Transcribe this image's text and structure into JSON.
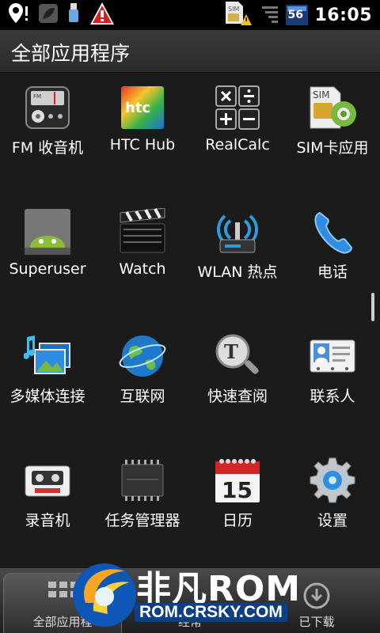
{
  "status_bar": {
    "time": "16:05",
    "network": "56",
    "sim_label": "SIM"
  },
  "header": {
    "title": "全部应用程序"
  },
  "apps": [
    {
      "label": "FM 收音机",
      "icon": "radio-icon"
    },
    {
      "label": "HTC Hub",
      "icon": "htc-hub-icon",
      "icon_text": "htc"
    },
    {
      "label": "RealCalc",
      "icon": "calculator-icon"
    },
    {
      "label": "SIM卡应用",
      "icon": "sim-toolkit-icon",
      "icon_text": "SIM"
    },
    {
      "label": "Superuser",
      "icon": "superuser-icon"
    },
    {
      "label": "Watch",
      "icon": "clapperboard-icon"
    },
    {
      "label": "WLAN 热点",
      "icon": "wifi-hotspot-icon"
    },
    {
      "label": "电话",
      "icon": "phone-icon"
    },
    {
      "label": "多媒体连接",
      "icon": "media-connect-icon"
    },
    {
      "label": "互联网",
      "icon": "globe-icon"
    },
    {
      "label": "快速查阅",
      "icon": "quick-lookup-icon"
    },
    {
      "label": "联系人",
      "icon": "contacts-icon"
    },
    {
      "label": "录音机",
      "icon": "voice-recorder-icon"
    },
    {
      "label": "任务管理器",
      "icon": "task-manager-icon"
    },
    {
      "label": "日历",
      "icon": "calendar-icon",
      "icon_text": "15"
    },
    {
      "label": "设置",
      "icon": "settings-gear-icon"
    }
  ],
  "tabs": [
    {
      "label": "全部应用程",
      "active": true
    },
    {
      "label": "经常",
      "active": false
    },
    {
      "label": "已下载",
      "active": false
    }
  ],
  "watermark": {
    "brand": "非凡ROM",
    "url": "ROM.CRSKY.COM"
  },
  "colors": {
    "background": "#1b1b1b",
    "status_bar": "#000000",
    "watermark_green": "#7ac943",
    "watermark_blue": "#0e3f86"
  }
}
